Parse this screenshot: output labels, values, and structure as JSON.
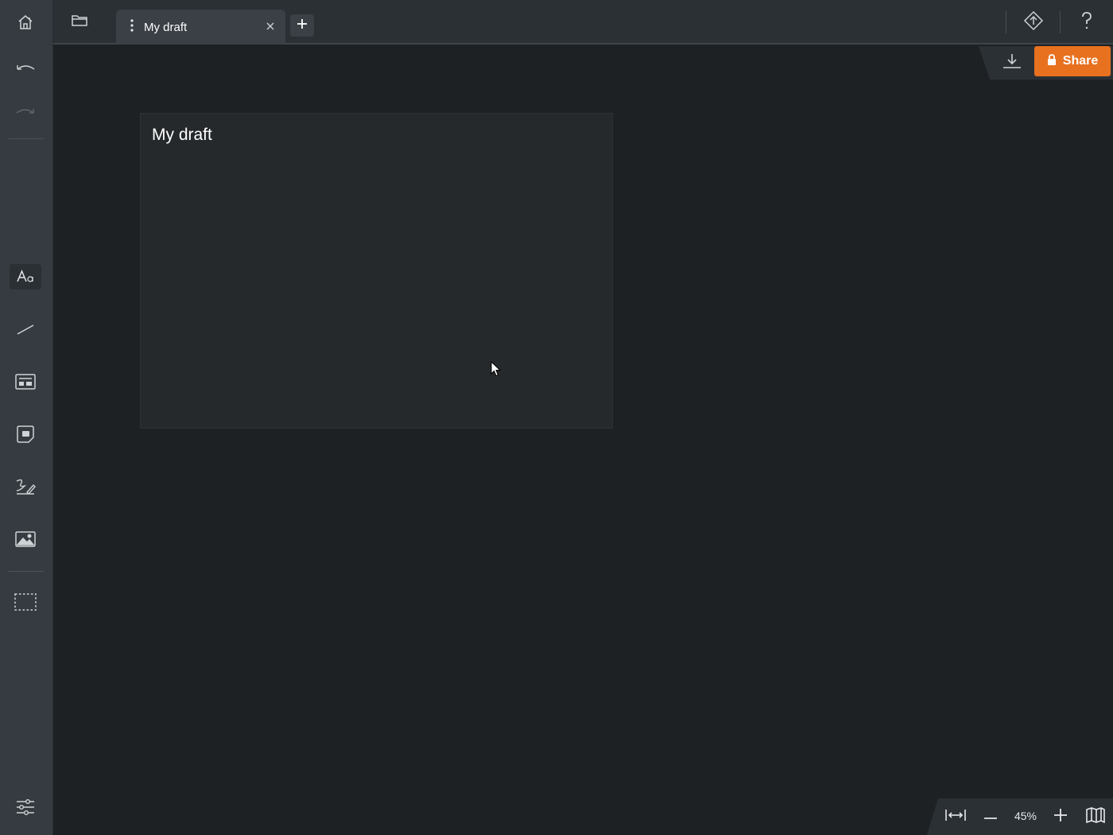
{
  "tab": {
    "title": "My draft"
  },
  "share_button": {
    "label": "Share"
  },
  "board": {
    "title": "My draft"
  },
  "zoom": {
    "level": "45%"
  },
  "icons": {
    "home": "home-icon",
    "folder": "folder-icon",
    "undo": "undo-icon",
    "redo": "redo-icon",
    "text": "text-tool-icon",
    "line": "line-tool-icon",
    "template": "template-icon",
    "sticky": "sticky-note-icon",
    "pen": "freehand-pen-icon",
    "image": "image-icon",
    "frame": "frame-select-icon",
    "settings": "settings-sliders-icon",
    "diamond": "diamond-icon",
    "help": "question-mark-icon",
    "download": "download-icon",
    "lock": "lock-icon",
    "fit_width": "fit-width-icon",
    "zoom_out": "minus-icon",
    "zoom_in": "plus-icon",
    "map": "map-icon"
  },
  "colors": {
    "accent": "#e8711f",
    "sidebar": "#353b40",
    "canvas": "#1e2124",
    "board": "#25292c"
  }
}
